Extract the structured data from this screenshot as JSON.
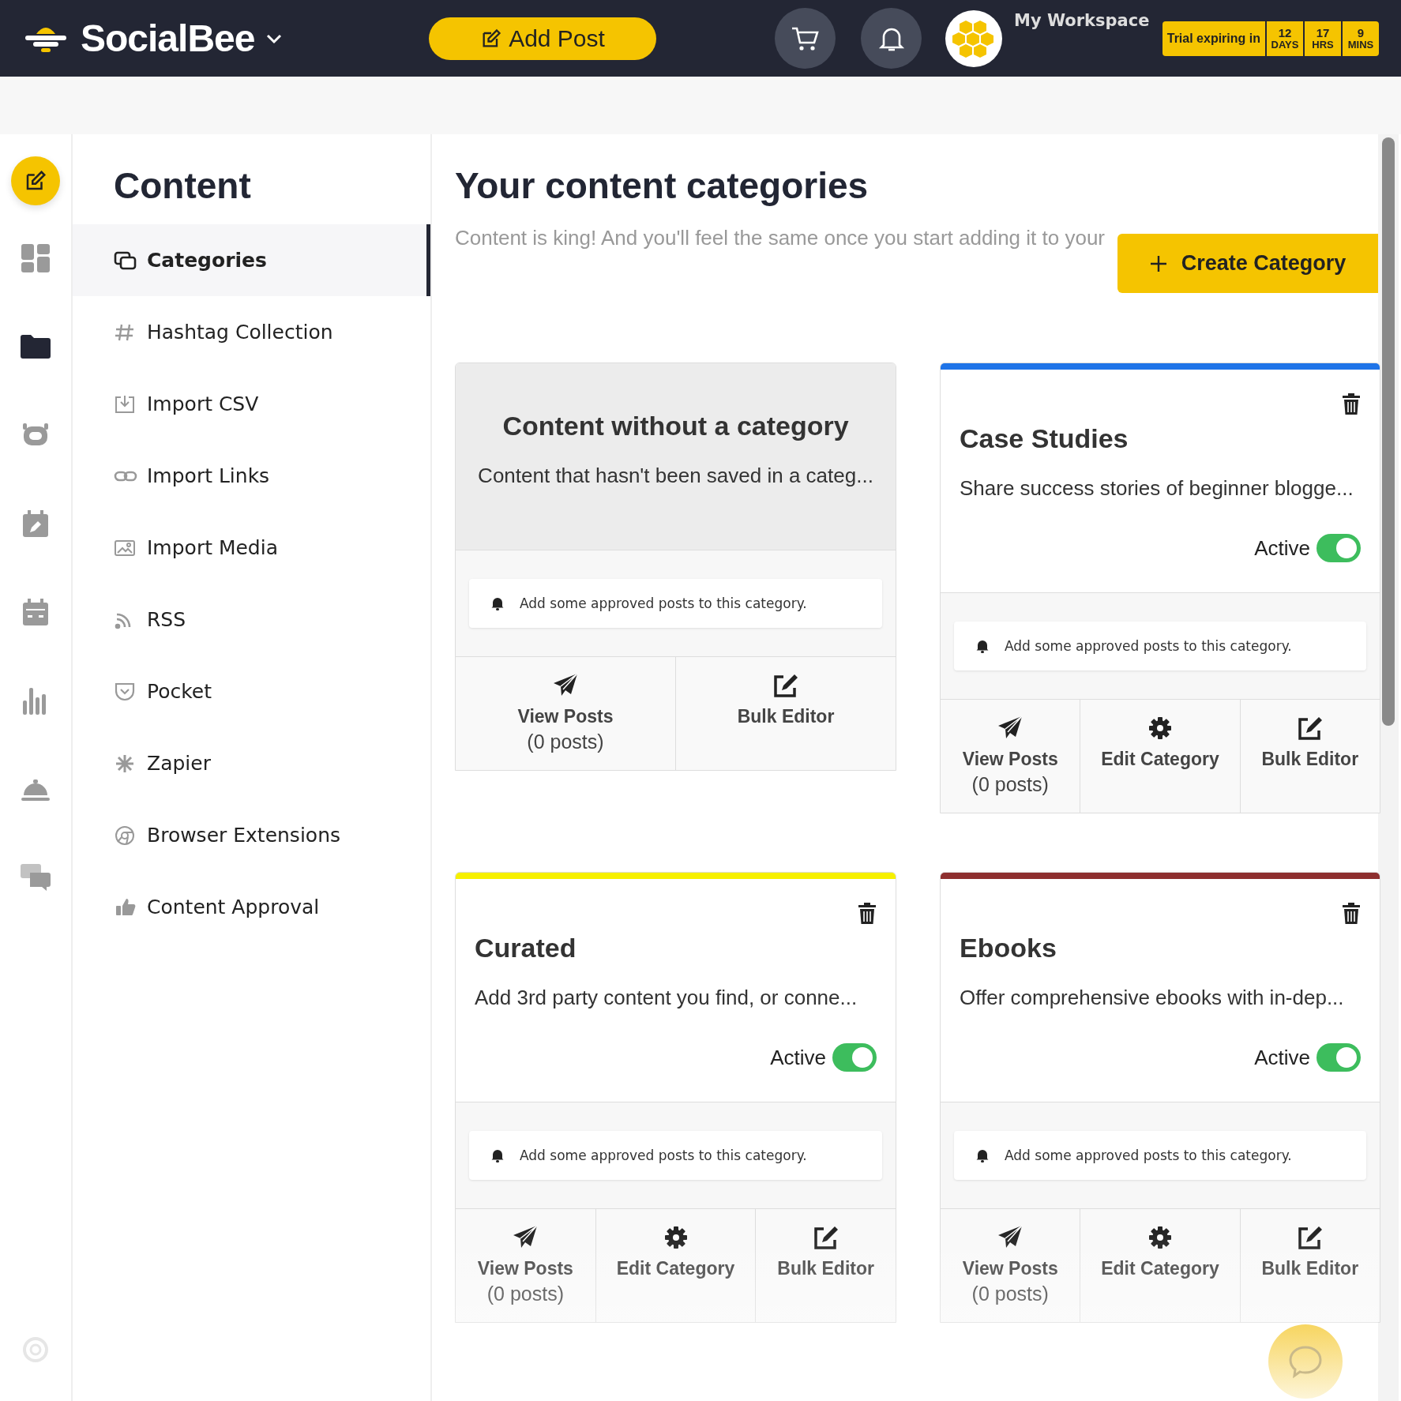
{
  "topbar": {
    "brand": "SocialBee",
    "add_post": "Add Post",
    "workspace": "My Workspace",
    "trial": {
      "label": "Trial expiring in",
      "countdown": [
        {
          "value": "12",
          "unit": "DAYS"
        },
        {
          "value": "17",
          "unit": "HRS"
        },
        {
          "value": "9",
          "unit": "MINS"
        }
      ]
    }
  },
  "rail": [
    {
      "kind": "dashboard",
      "selected": false
    },
    {
      "kind": "folder",
      "selected": true
    },
    {
      "kind": "bot",
      "selected": false
    },
    {
      "kind": "calendar-edit",
      "selected": false
    },
    {
      "kind": "calendar",
      "selected": false
    },
    {
      "kind": "analytics",
      "selected": false
    },
    {
      "kind": "service",
      "selected": false
    },
    {
      "kind": "chat",
      "selected": false
    }
  ],
  "sidebar": {
    "title": "Content",
    "items": [
      {
        "label": "Categories",
        "kind": "categories",
        "selected": true
      },
      {
        "label": "Hashtag Collection",
        "kind": "hashtag",
        "selected": false
      },
      {
        "label": "Import CSV",
        "kind": "import",
        "selected": false
      },
      {
        "label": "Import Links",
        "kind": "link",
        "selected": false
      },
      {
        "label": "Import Media",
        "kind": "image",
        "selected": false
      },
      {
        "label": "RSS",
        "kind": "rss",
        "selected": false
      },
      {
        "label": "Pocket",
        "kind": "pocket",
        "selected": false
      },
      {
        "label": "Zapier",
        "kind": "zapier",
        "selected": false
      },
      {
        "label": "Browser Extensions",
        "kind": "browser",
        "selected": false
      },
      {
        "label": "Content Approval",
        "kind": "thumb",
        "selected": false
      }
    ]
  },
  "main": {
    "title": "Your content categories",
    "subtitle": "Content is king! And you'll feel the same once you start adding it to your",
    "create_button": "Create Category",
    "categories": [
      {
        "kind": "uncategorized",
        "title": "Content without a category",
        "description": "Content that hasn't been saved in a categ...",
        "notice": "Add some approved posts to this category.",
        "actions": [
          {
            "kind": "view",
            "label": "View Posts",
            "sublabel": "(0 posts)"
          },
          {
            "kind": "bulk",
            "label": "Bulk Editor"
          }
        ]
      },
      {
        "kind": "category",
        "color": "#1f74e8",
        "title": "Case Studies",
        "description": "Share success stories of beginner blogge...",
        "status": "Active",
        "active": true,
        "notice": "Add some approved posts to this category.",
        "actions": [
          {
            "kind": "view",
            "label": "View Posts",
            "sublabel": "(0 posts)"
          },
          {
            "kind": "edit",
            "label": "Edit Category"
          },
          {
            "kind": "bulk",
            "label": "Bulk Editor"
          }
        ]
      },
      {
        "kind": "category",
        "color": "#f6f000",
        "title": "Curated",
        "description": "Add 3rd party content you find, or conne...",
        "status": "Active",
        "active": true,
        "notice": "Add some approved posts to this category.",
        "actions": [
          {
            "kind": "view",
            "label": "View Posts",
            "sublabel": "(0 posts)"
          },
          {
            "kind": "edit",
            "label": "Edit Category"
          },
          {
            "kind": "bulk",
            "label": "Bulk Editor"
          }
        ]
      },
      {
        "kind": "category",
        "color": "#8e2f2f",
        "title": "Ebooks",
        "description": "Offer comprehensive ebooks with in-dep...",
        "status": "Active",
        "active": true,
        "notice": "Add some approved posts to this category.",
        "actions": [
          {
            "kind": "view",
            "label": "View Posts",
            "sublabel": "(0 posts)"
          },
          {
            "kind": "edit",
            "label": "Edit Category"
          },
          {
            "kind": "bulk",
            "label": "Bulk Editor"
          }
        ]
      }
    ]
  }
}
